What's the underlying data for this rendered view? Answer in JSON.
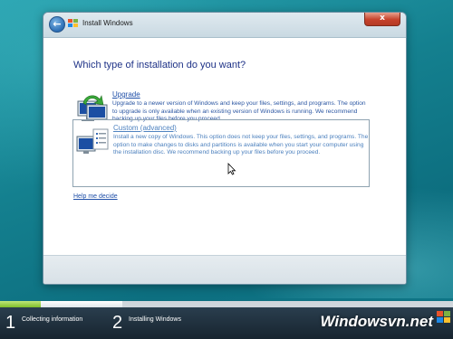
{
  "window": {
    "title": "Install Windows",
    "close_glyph": "x"
  },
  "main": {
    "heading": "Which type of installation do you want?",
    "options": [
      {
        "title": "Upgrade",
        "icon": "upgrade-computer-icon",
        "description": "Upgrade to a newer version of Windows and keep your files, settings, and programs. The option to upgrade is only available when an existing version of Windows is running. We recommend backing up your files before you proceed."
      },
      {
        "title": "Custom (advanced)",
        "icon": "custom-install-computer-icon",
        "description": "Install a new copy of Windows. This option does not keep your files, settings, and programs. The option to make changes to disks and partitions is available when you start your computer using the installation disc. We recommend backing up your files before you proceed."
      }
    ],
    "help_link": "Help me decide"
  },
  "progress": {
    "fraction_complete": 0.09,
    "steps": [
      {
        "number": "1",
        "label": "Collecting information"
      },
      {
        "number": "2",
        "label": "Installing Windows"
      }
    ]
  },
  "watermark": "Windowsvn.net",
  "colors": {
    "background": "#14808f",
    "link_blue": "#1f4fa8",
    "progress_green": "#7fbf2a",
    "close_red": "#c7422b"
  }
}
